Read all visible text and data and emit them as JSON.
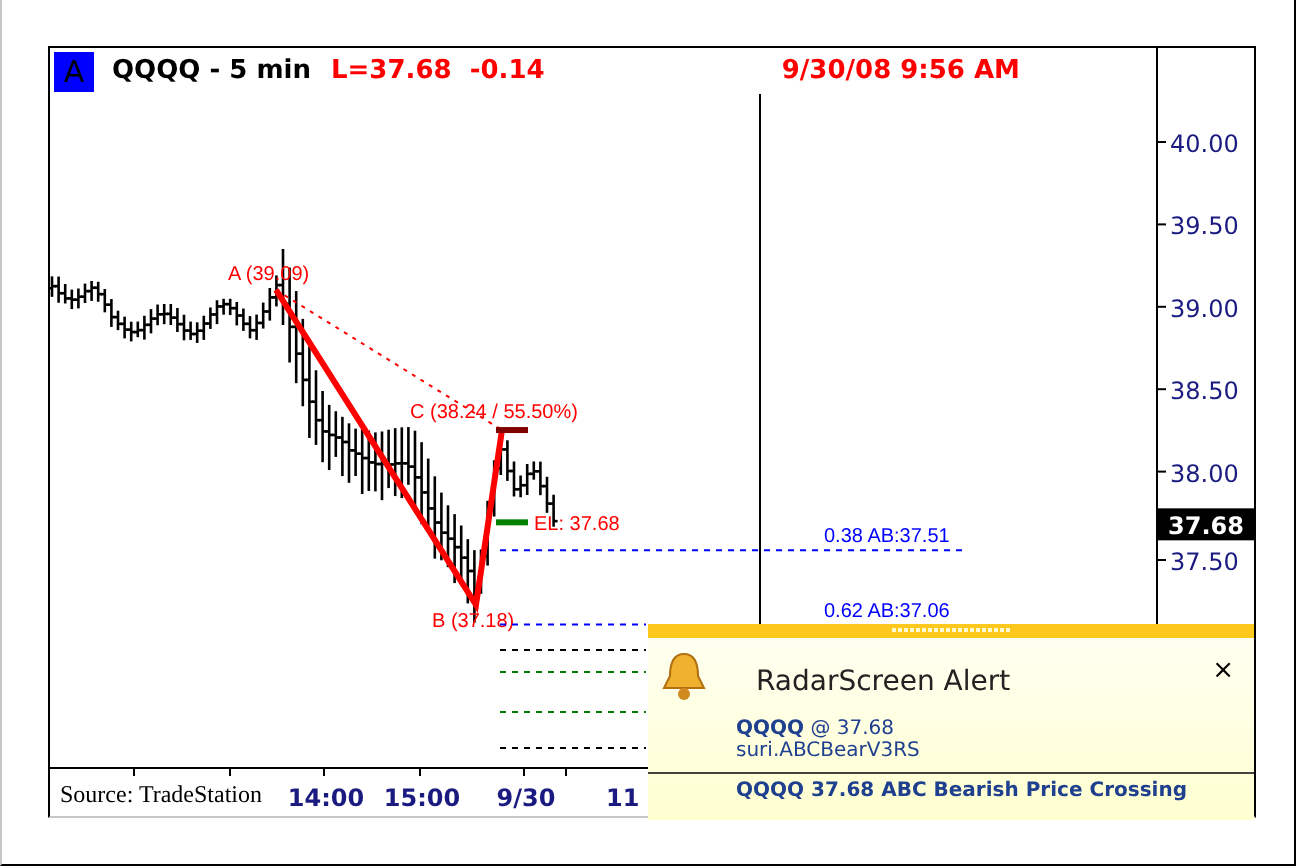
{
  "header": {
    "symbol_badge": "A",
    "symbol": "QQQQ - 5 min",
    "last": "L=37.68  -0.14",
    "datetime": "9/30/08 9:56 AM"
  },
  "price_axis": {
    "labels": [
      "40.00",
      "39.50",
      "39.00",
      "38.50",
      "38.00",
      "37.50"
    ],
    "current_price": "37.68"
  },
  "time_axis": {
    "labels": [
      "14:00",
      "15:00",
      "9/30",
      "11"
    ]
  },
  "source": "Source: TradeStation",
  "pattern": {
    "points": [
      {
        "label": "A (39.09)"
      },
      {
        "label": "B (37.18)"
      },
      {
        "label": "C (38.24 / 55.50%)"
      }
    ],
    "entry": "EL: 37.68"
  },
  "levels": [
    {
      "label": "0.38 AB:37.51"
    },
    {
      "label": "0.62 AB:37.06"
    }
  ],
  "alert": {
    "close": "×",
    "title": "RadarScreen Alert",
    "symbol": "QQQQ",
    "price": "@ 37.68",
    "strategy": "suri.ABCBearV3RS",
    "message": "QQQQ 37.68 ABC Bearish Price Crossing"
  }
}
